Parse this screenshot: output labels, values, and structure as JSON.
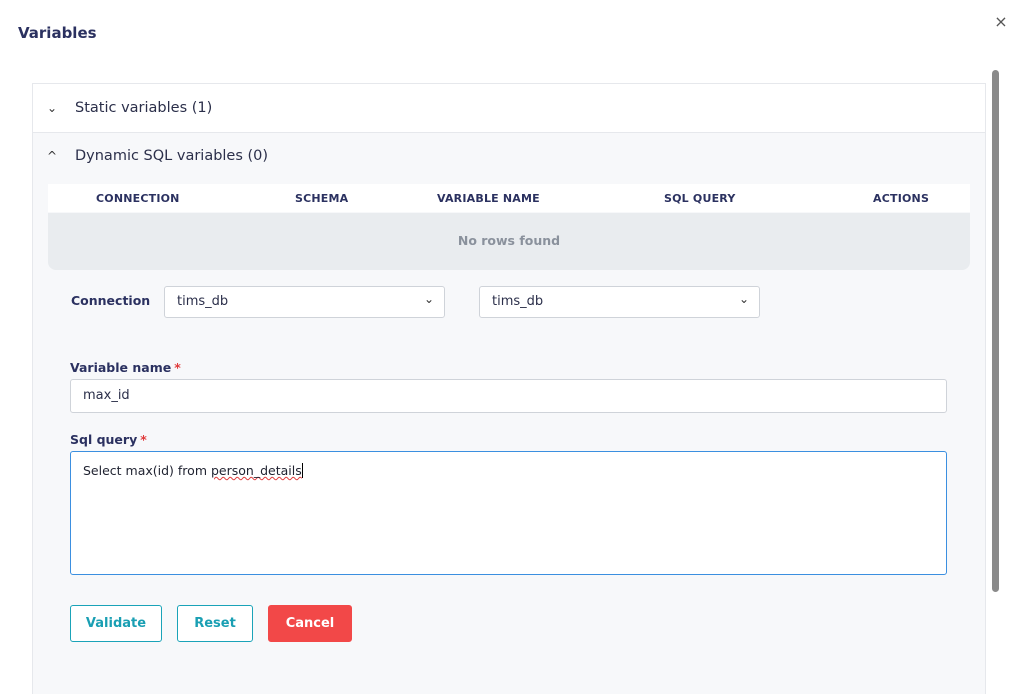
{
  "dialog": {
    "title": "Variables",
    "close_icon": "×"
  },
  "static_section": {
    "label": "Static variables (1)",
    "icon": "chevron-down-icon",
    "glyph": "⌄"
  },
  "dynamic_section": {
    "label": "Dynamic SQL variables (0)",
    "icon": "chevron-up-icon",
    "glyph": "^"
  },
  "table": {
    "columns": [
      "CONNECTION",
      "SCHEMA",
      "VARIABLE NAME",
      "SQL QUERY",
      "ACTIONS"
    ],
    "empty_text": "No rows found"
  },
  "form": {
    "connection_label": "Connection",
    "connection_value": "tims_db",
    "schema_value": "tims_db",
    "variable_name_label": "Variable name",
    "required_mark": "*",
    "variable_name_value": "max_id",
    "sql_query_label": "Sql query",
    "sql_query_prefix": "Select max(id) from ",
    "sql_query_misspelled": "person_details"
  },
  "buttons": {
    "validate": "Validate",
    "reset": "Reset",
    "cancel": "Cancel"
  },
  "colors": {
    "accent": "#1aa3b8",
    "danger": "#f24848",
    "title": "#2b3160"
  }
}
